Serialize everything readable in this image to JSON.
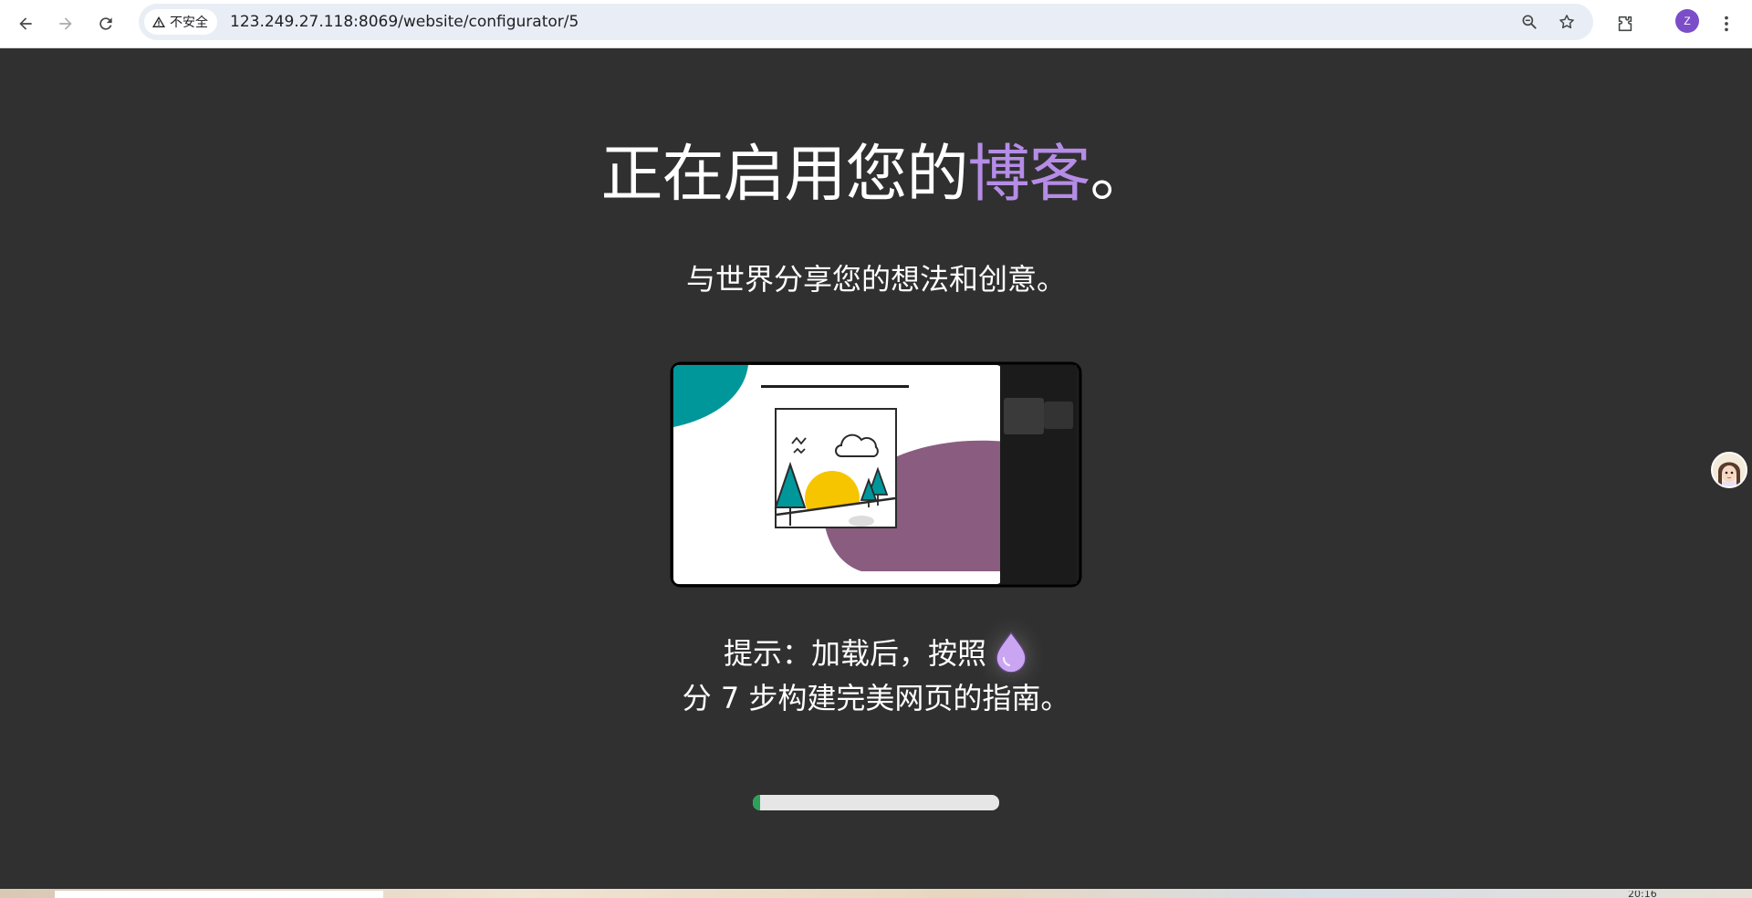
{
  "browser": {
    "security_label": "不安全",
    "url": "123.249.27.118:8069/website/configurator/5",
    "profile_initial": "Z",
    "icons": [
      "back-arrow-icon",
      "forward-arrow-icon",
      "reload-icon",
      "warning-icon",
      "zoom-icon",
      "star-icon",
      "extensions-icon",
      "more-vert-icon"
    ]
  },
  "page": {
    "headline_main": "正在启用您的",
    "headline_accent": "博客",
    "headline_end": "。",
    "subtitle": "与世界分享您的想法和创意。",
    "tip_line1": "提示：加载后，按照",
    "tip_line2": "分 7 步构建完美网页的指南。",
    "progress_fraction": 0.03,
    "colors": {
      "background": "#303030",
      "accent": "#b58ce6",
      "progress": "#2ba15a",
      "teal": "#00979b",
      "purple": "#8a5d80",
      "sun": "#f7c500"
    }
  },
  "taskbar": {
    "clock": "20:16"
  }
}
